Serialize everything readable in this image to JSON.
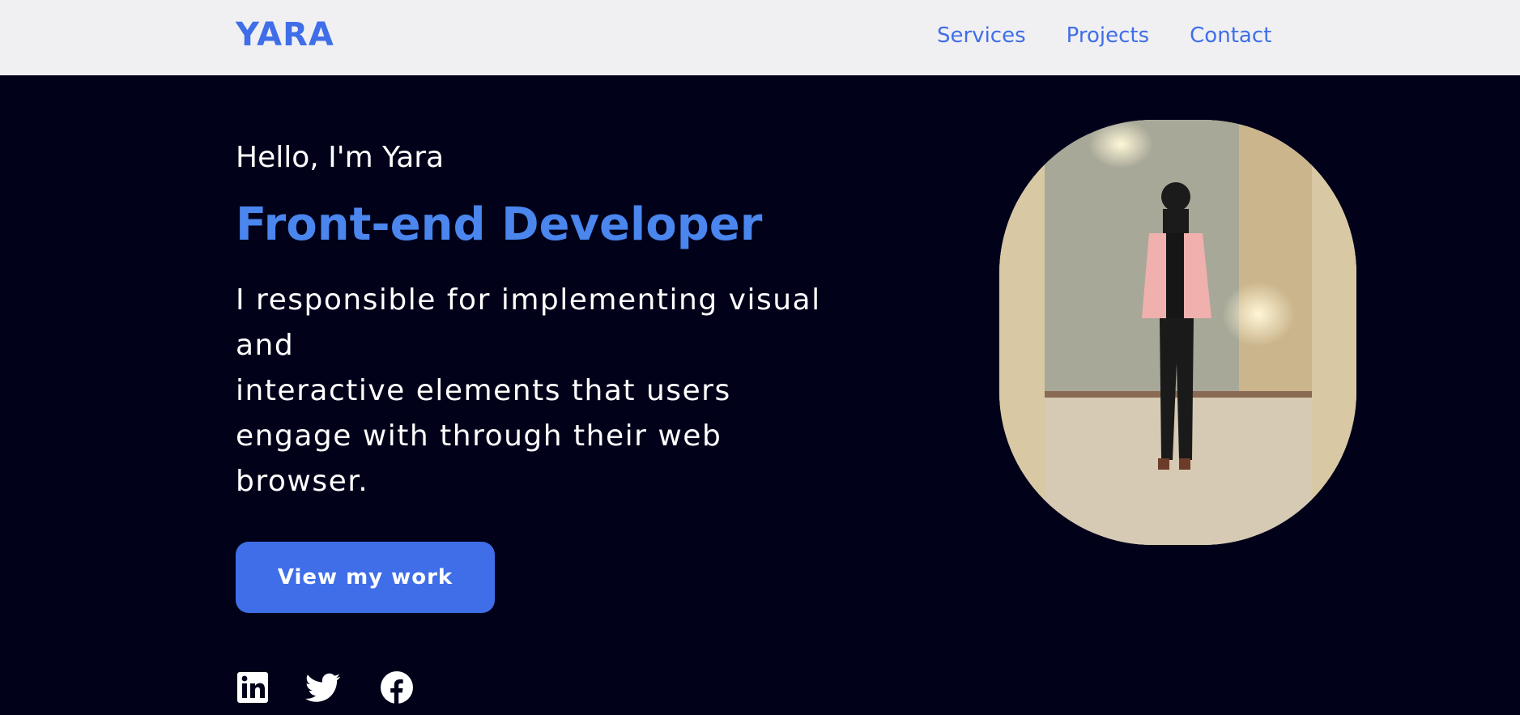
{
  "nav": {
    "logo": "YARA",
    "links": [
      "Services",
      "Projects",
      "Contact"
    ]
  },
  "hero": {
    "greeting": "Hello, I'm Yara",
    "role": "Front-end Developer",
    "description_lines": [
      "I responsible for implementing visual",
      "and",
      "interactive elements that users",
      "engage with through their web",
      "browser."
    ],
    "cta_label": "View my work",
    "social_icons": [
      "linkedin-icon",
      "twitter-icon",
      "facebook-icon"
    ],
    "photo_icon": "profile-photo"
  },
  "colors": {
    "background": "#01011a",
    "navbar": "#f0f0f2",
    "accent": "#3f6ee8",
    "role": "#4a86ed",
    "text": "#ffffff"
  }
}
